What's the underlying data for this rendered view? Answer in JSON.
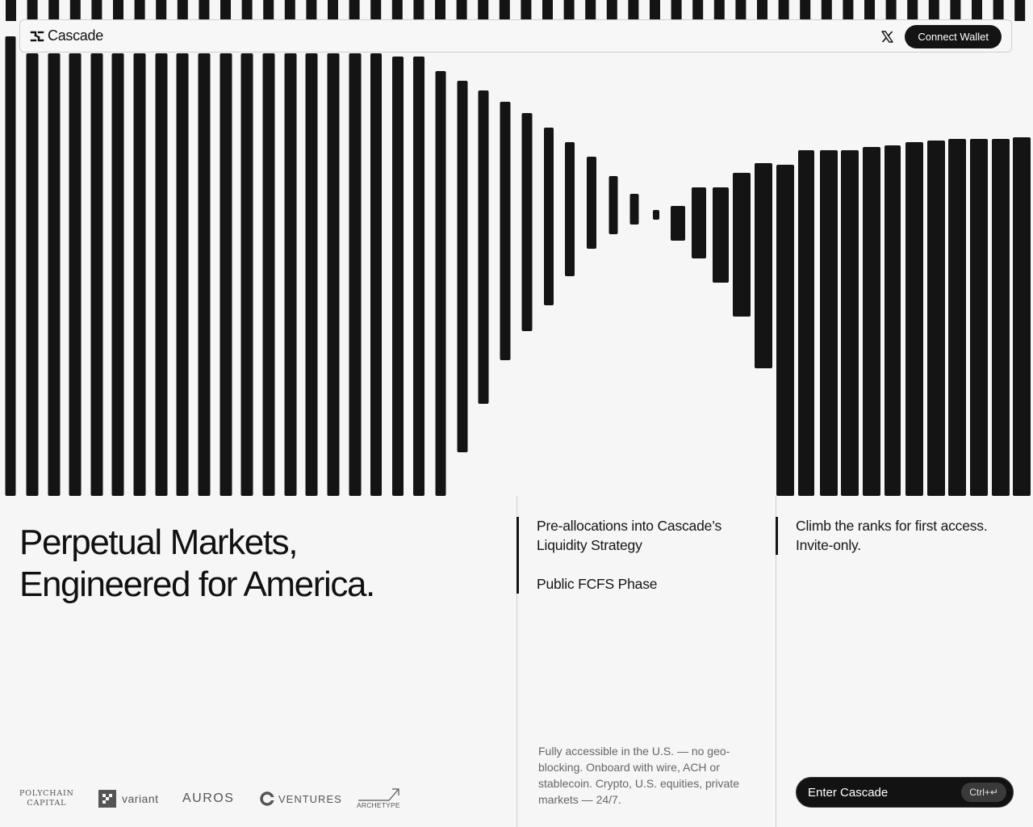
{
  "brand": {
    "name": "Cascade"
  },
  "nav": {
    "x_icon": "x-logo-icon",
    "connect_label": "Connect Wallet"
  },
  "hero": {
    "headline_line1": "Perpetual Markets,",
    "headline_line2": "Engineered for America."
  },
  "backers": {
    "polychain_line1": "POLYCHAIN",
    "polychain_line2": "CAPITAL",
    "variant": "variant",
    "auros": "AUROS",
    "ventures": "VENTURES",
    "archetype": "ARCHETYPE"
  },
  "middle": {
    "prealloc": "Pre-allocations into Cascade’s Liquidity Strategy",
    "phase": "Public FCFS Phase",
    "description": "Fully accessible in the U.S. — no geo-blocking. Onboard with wire, ACH or stablecoin. Crypto, U.S. equities, private markets — 24/7."
  },
  "right": {
    "climb": "Climb the ranks for first access. Invite-only.",
    "enter_label": "Enter Cascade",
    "shortcut": "Ctrl+↵"
  },
  "colors": {
    "background": "#f6f6f6",
    "ink": "#141414",
    "border": "#cfcfcf",
    "muted_text": "#666666"
  }
}
